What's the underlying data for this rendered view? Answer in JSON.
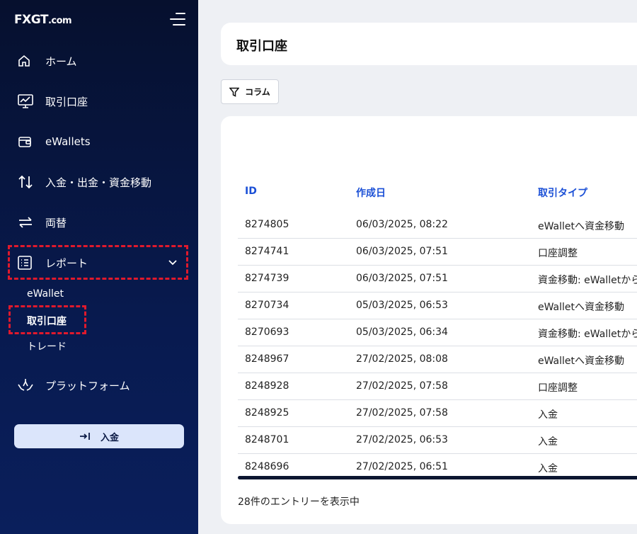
{
  "brand": {
    "logo_main": "FXGT",
    "logo_suffix": ".com"
  },
  "sidebar": {
    "items": [
      {
        "label": "ホーム",
        "icon": "home-icon"
      },
      {
        "label": "取引口座",
        "icon": "chart-monitor-icon"
      },
      {
        "label": "eWallets",
        "icon": "wallet-icon"
      },
      {
        "label": "入金・出金・資金移動",
        "icon": "transfer-arrows-icon"
      },
      {
        "label": "両替",
        "icon": "exchange-icon"
      },
      {
        "label": "レポート",
        "icon": "report-list-icon"
      },
      {
        "label": "プラットフォーム",
        "icon": "platform-hands-icon"
      }
    ],
    "report_sub": [
      {
        "label": "eWallet"
      },
      {
        "label": "取引口座"
      },
      {
        "label": "トレード"
      }
    ],
    "deposit_label": "入金"
  },
  "main": {
    "title": "取引口座",
    "columns_button": "コラム",
    "headers": {
      "id": "ID",
      "created": "作成日",
      "type": "取引タイプ"
    },
    "rows": [
      {
        "id": "8274805",
        "date": "06/03/2025, 08:22",
        "type": "eWalletへ資金移動"
      },
      {
        "id": "8274741",
        "date": "06/03/2025, 07:51",
        "type": "口座調整"
      },
      {
        "id": "8274739",
        "date": "06/03/2025, 07:51",
        "type": "資金移動: eWalletから"
      },
      {
        "id": "8270734",
        "date": "05/03/2025, 06:53",
        "type": "eWalletへ資金移動"
      },
      {
        "id": "8270693",
        "date": "05/03/2025, 06:34",
        "type": "資金移動: eWalletから"
      },
      {
        "id": "8248967",
        "date": "27/02/2025, 08:08",
        "type": "eWalletへ資金移動"
      },
      {
        "id": "8248928",
        "date": "27/02/2025, 07:58",
        "type": "口座調整"
      },
      {
        "id": "8248925",
        "date": "27/02/2025, 07:58",
        "type": "入金"
      },
      {
        "id": "8248701",
        "date": "27/02/2025, 06:53",
        "type": "入金"
      },
      {
        "id": "8248696",
        "date": "27/02/2025, 06:51",
        "type": "入金"
      }
    ],
    "footer": "28件のエントリーを表示中"
  },
  "colors": {
    "sidebar_bg": "#06102e",
    "accent_blue": "#1a4fd6",
    "highlight_dash": "#e0192c",
    "deposit_btn_bg": "#dbe5fb"
  }
}
